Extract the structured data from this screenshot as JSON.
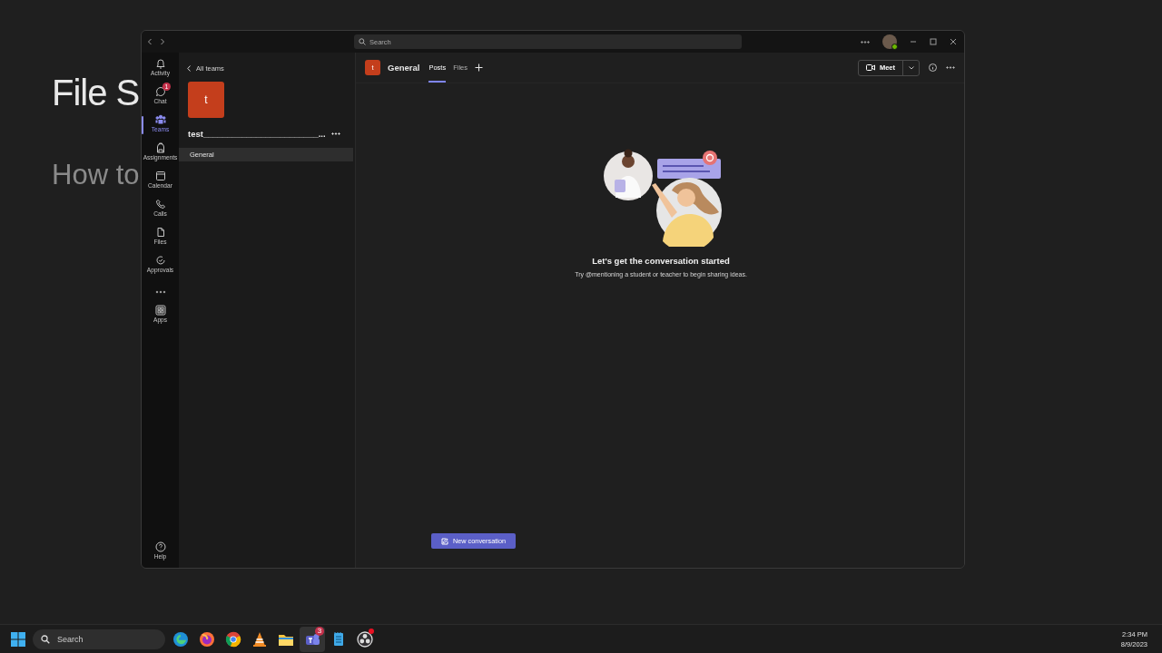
{
  "slide": {
    "title": "File S",
    "subtitle": "How to"
  },
  "titlebar": {
    "search_placeholder": "Search"
  },
  "rail": [
    {
      "kind": "item",
      "label": "Activity",
      "selected": false
    },
    {
      "kind": "item",
      "label": "Chat",
      "selected": false,
      "badge": "1"
    },
    {
      "kind": "item",
      "label": "Teams",
      "selected": true
    },
    {
      "kind": "item",
      "label": "Assignments",
      "selected": false
    },
    {
      "kind": "item",
      "label": "Calendar",
      "selected": false
    },
    {
      "kind": "item",
      "label": "Calls",
      "selected": false
    },
    {
      "kind": "item",
      "label": "Files",
      "selected": false
    },
    {
      "kind": "item",
      "label": "Approvals",
      "selected": false
    },
    {
      "kind": "more"
    },
    {
      "kind": "item",
      "label": "Apps",
      "selected": false
    }
  ],
  "rail_footer": {
    "label": "Help"
  },
  "team": {
    "back_label": "All teams",
    "avatar_letter": "t",
    "name": "test________________________...",
    "channels": [
      {
        "name": "General",
        "selected": true
      }
    ]
  },
  "channel_header": {
    "avatar_letter": "t",
    "title": "General",
    "tabs": [
      {
        "label": "Posts",
        "selected": true
      },
      {
        "label": "Files",
        "selected": false
      }
    ],
    "meet_label": "Meet"
  },
  "empty_state": {
    "heading": "Let's get the conversation started",
    "text": "Try @mentioning a student or teacher to begin sharing ideas."
  },
  "new_conversation": "New conversation",
  "taskbar": {
    "search_placeholder": "Search",
    "apps": [
      {
        "selected": false,
        "alert": false
      },
      {
        "selected": false,
        "alert": false
      },
      {
        "selected": false,
        "alert": false
      },
      {
        "selected": false,
        "alert": false
      },
      {
        "selected": false,
        "alert": false
      },
      {
        "selected": true,
        "alert": false,
        "badge": "3"
      },
      {
        "selected": false,
        "alert": false
      },
      {
        "selected": false,
        "alert": true
      }
    ],
    "time": "2:34 PM",
    "date": "8/9/2023"
  }
}
